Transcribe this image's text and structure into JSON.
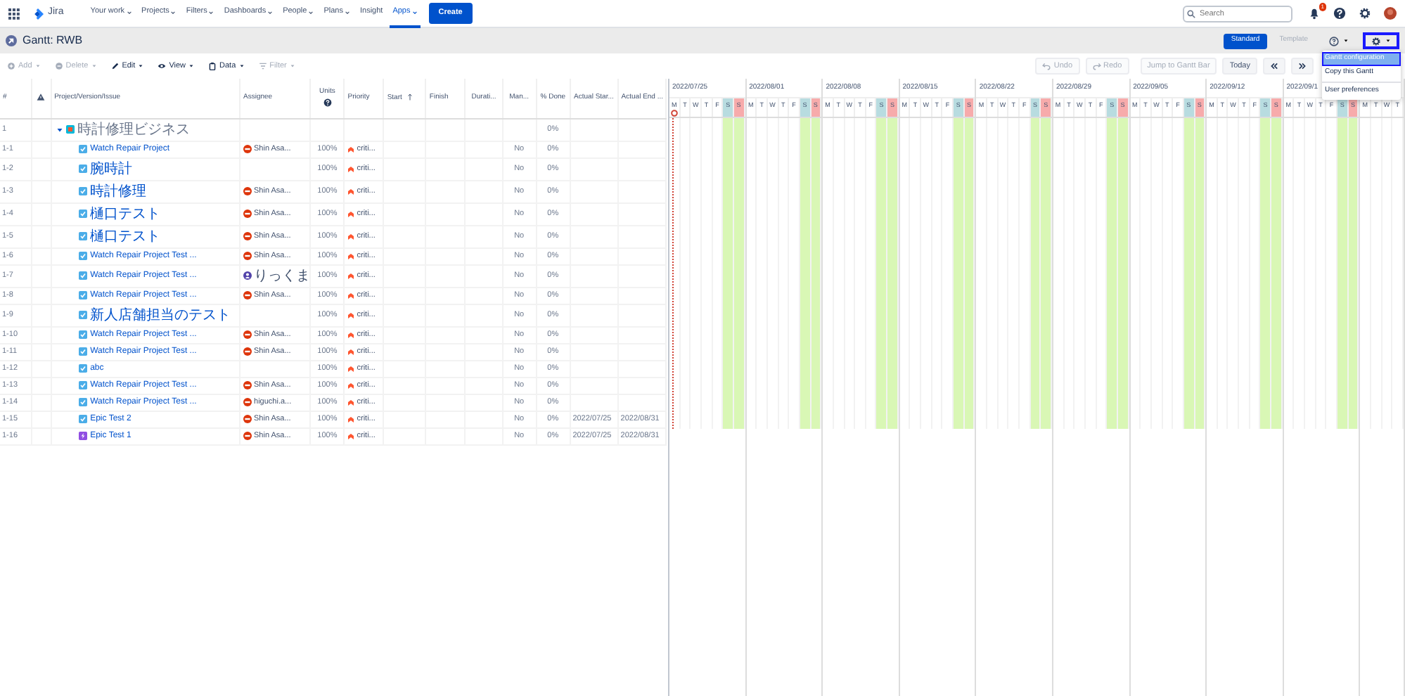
{
  "topnav": {
    "items": [
      {
        "label": "Your work",
        "dropdown": true,
        "selected": false
      },
      {
        "label": "Projects",
        "dropdown": true,
        "selected": false
      },
      {
        "label": "Filters",
        "dropdown": true,
        "selected": false
      },
      {
        "label": "Dashboards",
        "dropdown": true,
        "selected": false
      },
      {
        "label": "People",
        "dropdown": true,
        "selected": false
      },
      {
        "label": "Plans",
        "dropdown": true,
        "selected": false
      },
      {
        "label": "Insight",
        "dropdown": false,
        "selected": false
      },
      {
        "label": "Apps",
        "dropdown": true,
        "selected": true
      }
    ],
    "logo": "Jira",
    "create": "Create",
    "search": {
      "placeholder": "Search"
    },
    "notification_count": "1"
  },
  "header": {
    "title": "Gantt: RWB",
    "modes": [
      {
        "label": "Standard",
        "selected": true
      },
      {
        "label": "Template",
        "selected": false
      }
    ],
    "settings_active": true
  },
  "toolbar": {
    "left": [
      {
        "label": "Add",
        "disabled": true
      },
      {
        "label": "Delete",
        "disabled": true
      },
      {
        "label": "Edit",
        "disabled": false
      },
      {
        "label": "View",
        "disabled": false
      },
      {
        "label": "Data",
        "disabled": false
      },
      {
        "label": "Filter",
        "disabled": true
      }
    ],
    "right": [
      {
        "label": "Undo",
        "disabled": true
      },
      {
        "label": "Redo",
        "disabled": true
      },
      {
        "label": "Jump to Gantt Bar",
        "disabled": true
      },
      {
        "label": "Today",
        "disabled": false
      }
    ]
  },
  "menu": {
    "sections": [
      [
        {
          "label": "Gantt configuration",
          "selected": true
        },
        {
          "label": "Copy this Gantt",
          "selected": false
        }
      ],
      [
        {
          "label": "User preferences",
          "selected": false
        }
      ]
    ]
  },
  "table": {
    "columns": [
      {
        "kind": "text",
        "label": "#"
      },
      {
        "kind": "warning"
      },
      {
        "kind": "text",
        "label": "Project/Version/Issue"
      },
      {
        "kind": "text",
        "label": "Assignee"
      },
      {
        "kind": "help",
        "label": "Units"
      },
      {
        "kind": "text",
        "label": "Priority"
      },
      {
        "kind": "text",
        "label": "Start",
        "sorted": true
      },
      {
        "kind": "text",
        "label": "Finish"
      },
      {
        "kind": "text",
        "label": "Durati..."
      },
      {
        "kind": "text",
        "label": "Man..."
      },
      {
        "kind": "text",
        "label": "% Done"
      },
      {
        "kind": "text",
        "label": "Actual Star..."
      },
      {
        "kind": "text",
        "label": "Actual End ..."
      }
    ],
    "rows": [
      {
        "number": "1",
        "kind": "project",
        "issue": "時計修理ビジネス",
        "expanded": true,
        "done": "0%",
        "children": [
          {
            "number": "1-1",
            "kind": "task",
            "issue": "Watch Repair Project",
            "assignee": "Shin Asa...",
            "avatar": {
              "kind": "photo"
            },
            "units": "100%",
            "priority": "criti...",
            "manual": "No",
            "done": "0%"
          },
          {
            "number": "1-2",
            "kind": "task",
            "issue": "腕時計",
            "units": "100%",
            "priority": "criti...",
            "manual": "No",
            "done": "0%"
          },
          {
            "number": "1-3",
            "kind": "task",
            "issue": "時計修理",
            "assignee": "Shin Asa...",
            "avatar": {
              "kind": "photo"
            },
            "units": "100%",
            "priority": "criti...",
            "manual": "No",
            "done": "0%"
          },
          {
            "number": "1-4",
            "kind": "task",
            "issue": "樋口テスト",
            "assignee": "Shin Asa...",
            "avatar": {
              "kind": "photo"
            },
            "units": "100%",
            "priority": "criti...",
            "manual": "No",
            "done": "0%"
          },
          {
            "number": "1-5",
            "kind": "task",
            "issue": "樋口テスト",
            "assignee": "Shin Asa...",
            "avatar": {
              "kind": "photo"
            },
            "units": "100%",
            "priority": "criti...",
            "manual": "No",
            "done": "0%"
          },
          {
            "number": "1-6",
            "kind": "task",
            "issue": "Watch Repair Project Test ...",
            "assignee": "Shin Asa...",
            "avatar": {
              "kind": "photo"
            },
            "units": "100%",
            "priority": "criti...",
            "manual": "No",
            "done": "0%"
          },
          {
            "number": "1-7",
            "kind": "task",
            "issue": "Watch Repair Project Test ...",
            "assignee": "りっくま",
            "avatar": {
              "kind": "user"
            },
            "units": "100%",
            "priority": "criti...",
            "manual": "No",
            "done": "0%"
          },
          {
            "number": "1-8",
            "kind": "task",
            "issue": "Watch Repair Project Test ...",
            "assignee": "Shin Asa...",
            "avatar": {
              "kind": "photo"
            },
            "units": "100%",
            "priority": "criti...",
            "manual": "No",
            "done": "0%"
          },
          {
            "number": "1-9",
            "kind": "task",
            "issue": "新人店舗担当のテスト",
            "units": "100%",
            "priority": "criti...",
            "manual": "No",
            "done": "0%"
          },
          {
            "number": "1-10",
            "kind": "task",
            "issue": "Watch Repair Project Test ...",
            "assignee": "Shin Asa...",
            "avatar": {
              "kind": "photo"
            },
            "units": "100%",
            "priority": "criti...",
            "manual": "No",
            "done": "0%"
          },
          {
            "number": "1-11",
            "kind": "task",
            "issue": "Watch Repair Project Test ...",
            "assignee": "Shin Asa...",
            "avatar": {
              "kind": "photo"
            },
            "units": "100%",
            "priority": "criti...",
            "manual": "No",
            "done": "0%"
          },
          {
            "number": "1-12",
            "kind": "task",
            "issue": "abc",
            "units": "100%",
            "priority": "criti...",
            "manual": "No",
            "done": "0%"
          },
          {
            "number": "1-13",
            "kind": "task",
            "issue": "Watch Repair Project Test ...",
            "assignee": "Shin Asa...",
            "avatar": {
              "kind": "photo"
            },
            "units": "100%",
            "priority": "criti...",
            "manual": "No",
            "done": "0%"
          },
          {
            "number": "1-14",
            "kind": "task",
            "issue": "Watch Repair Project Test ...",
            "assignee": "higuchi.a...",
            "avatar": {
              "kind": "photo"
            },
            "units": "100%",
            "priority": "criti...",
            "manual": "No",
            "done": "0%"
          },
          {
            "number": "1-15",
            "kind": "task",
            "issue": "Epic Test 2",
            "assignee": "Shin Asa...",
            "avatar": {
              "kind": "photo"
            },
            "units": "100%",
            "priority": "criti...",
            "manual": "No",
            "done": "0%",
            "actual_start": "2022/07/25",
            "actual_end": "2022/08/31"
          },
          {
            "number": "1-16",
            "kind": "epic",
            "issue": "Epic Test 1",
            "assignee": "Shin Asa...",
            "avatar": {
              "kind": "photo"
            },
            "units": "100%",
            "priority": "criti...",
            "manual": "No",
            "done": "0%",
            "actual_start": "2022/07/25",
            "actual_end": "2022/08/31"
          }
        ]
      }
    ]
  },
  "gantt": {
    "weeks": [
      {
        "label": "2022/07/25",
        "days": [
          {
            "letter": "M",
            "kind": "weekday",
            "today": true
          },
          {
            "letter": "T",
            "kind": "weekday",
            "today": false
          },
          {
            "letter": "W",
            "kind": "weekday",
            "today": false
          },
          {
            "letter": "T",
            "kind": "weekday",
            "today": false
          },
          {
            "letter": "F",
            "kind": "weekday",
            "today": false
          },
          {
            "letter": "S",
            "kind": "saturday",
            "today": false
          },
          {
            "letter": "S",
            "kind": "sunday",
            "today": false
          }
        ]
      },
      {
        "label": "2022/08/01",
        "days": [
          {
            "letter": "M",
            "kind": "weekday",
            "today": false
          },
          {
            "letter": "T",
            "kind": "weekday",
            "today": false
          },
          {
            "letter": "W",
            "kind": "weekday",
            "today": false
          },
          {
            "letter": "T",
            "kind": "weekday",
            "today": false
          },
          {
            "letter": "F",
            "kind": "weekday",
            "today": false
          },
          {
            "letter": "S",
            "kind": "saturday",
            "today": false
          },
          {
            "letter": "S",
            "kind": "sunday",
            "today": false
          }
        ]
      },
      {
        "label": "2022/08/08",
        "days": [
          {
            "letter": "M",
            "kind": "weekday",
            "today": false
          },
          {
            "letter": "T",
            "kind": "weekday",
            "today": false
          },
          {
            "letter": "W",
            "kind": "weekday",
            "today": false
          },
          {
            "letter": "T",
            "kind": "weekday",
            "today": false
          },
          {
            "letter": "F",
            "kind": "weekday",
            "today": false
          },
          {
            "letter": "S",
            "kind": "saturday",
            "today": false
          },
          {
            "letter": "S",
            "kind": "sunday",
            "today": false
          }
        ]
      },
      {
        "label": "2022/08/15",
        "days": [
          {
            "letter": "M",
            "kind": "weekday",
            "today": false
          },
          {
            "letter": "T",
            "kind": "weekday",
            "today": false
          },
          {
            "letter": "W",
            "kind": "weekday",
            "today": false
          },
          {
            "letter": "T",
            "kind": "weekday",
            "today": false
          },
          {
            "letter": "F",
            "kind": "weekday",
            "today": false
          },
          {
            "letter": "S",
            "kind": "saturday",
            "today": false
          },
          {
            "letter": "S",
            "kind": "sunday",
            "today": false
          }
        ]
      },
      {
        "label": "2022/08/22",
        "days": [
          {
            "letter": "M",
            "kind": "weekday",
            "today": false
          },
          {
            "letter": "T",
            "kind": "weekday",
            "today": false
          },
          {
            "letter": "W",
            "kind": "weekday",
            "today": false
          },
          {
            "letter": "T",
            "kind": "weekday",
            "today": false
          },
          {
            "letter": "F",
            "kind": "weekday",
            "today": false
          },
          {
            "letter": "S",
            "kind": "saturday",
            "today": false
          },
          {
            "letter": "S",
            "kind": "sunday",
            "today": false
          }
        ]
      },
      {
        "label": "2022/08/29",
        "days": [
          {
            "letter": "M",
            "kind": "weekday",
            "today": false
          },
          {
            "letter": "T",
            "kind": "weekday",
            "today": false
          },
          {
            "letter": "W",
            "kind": "weekday",
            "today": false
          },
          {
            "letter": "T",
            "kind": "weekday",
            "today": false
          },
          {
            "letter": "F",
            "kind": "weekday",
            "today": false
          },
          {
            "letter": "S",
            "kind": "saturday",
            "today": false
          },
          {
            "letter": "S",
            "kind": "sunday",
            "today": false
          }
        ]
      },
      {
        "label": "2022/09/05",
        "days": [
          {
            "letter": "M",
            "kind": "weekday",
            "today": false
          },
          {
            "letter": "T",
            "kind": "weekday",
            "today": false
          },
          {
            "letter": "W",
            "kind": "weekday",
            "today": false
          },
          {
            "letter": "T",
            "kind": "weekday",
            "today": false
          },
          {
            "letter": "F",
            "kind": "weekday",
            "today": false
          },
          {
            "letter": "S",
            "kind": "saturday",
            "today": false
          },
          {
            "letter": "S",
            "kind": "sunday",
            "today": false
          }
        ]
      },
      {
        "label": "2022/09/12",
        "days": [
          {
            "letter": "M",
            "kind": "weekday",
            "today": false
          },
          {
            "letter": "T",
            "kind": "weekday",
            "today": false
          },
          {
            "letter": "W",
            "kind": "weekday",
            "today": false
          },
          {
            "letter": "T",
            "kind": "weekday",
            "today": false
          },
          {
            "letter": "F",
            "kind": "weekday",
            "today": false
          },
          {
            "letter": "S",
            "kind": "saturday",
            "today": false
          },
          {
            "letter": "S",
            "kind": "sunday",
            "today": false
          }
        ]
      },
      {
        "label": "2022/09/1",
        "days": [
          {
            "letter": "M",
            "kind": "weekday",
            "today": false
          },
          {
            "letter": "T",
            "kind": "weekday",
            "today": false
          },
          {
            "letter": "W",
            "kind": "weekday",
            "today": false
          },
          {
            "letter": "T",
            "kind": "weekday",
            "today": false
          },
          {
            "letter": "F",
            "kind": "weekday",
            "today": false
          },
          {
            "letter": "S",
            "kind": "saturday",
            "today": false
          },
          {
            "letter": "S",
            "kind": "sunday",
            "today": false
          }
        ]
      },
      {
        "days": [
          {
            "letter": "M",
            "kind": "weekday",
            "today": false
          },
          {
            "letter": "T",
            "kind": "weekday",
            "today": false
          },
          {
            "letter": "W",
            "kind": "weekday",
            "today": false
          },
          {
            "letter": "T",
            "kind": "weekday",
            "today": false
          }
        ]
      }
    ]
  }
}
